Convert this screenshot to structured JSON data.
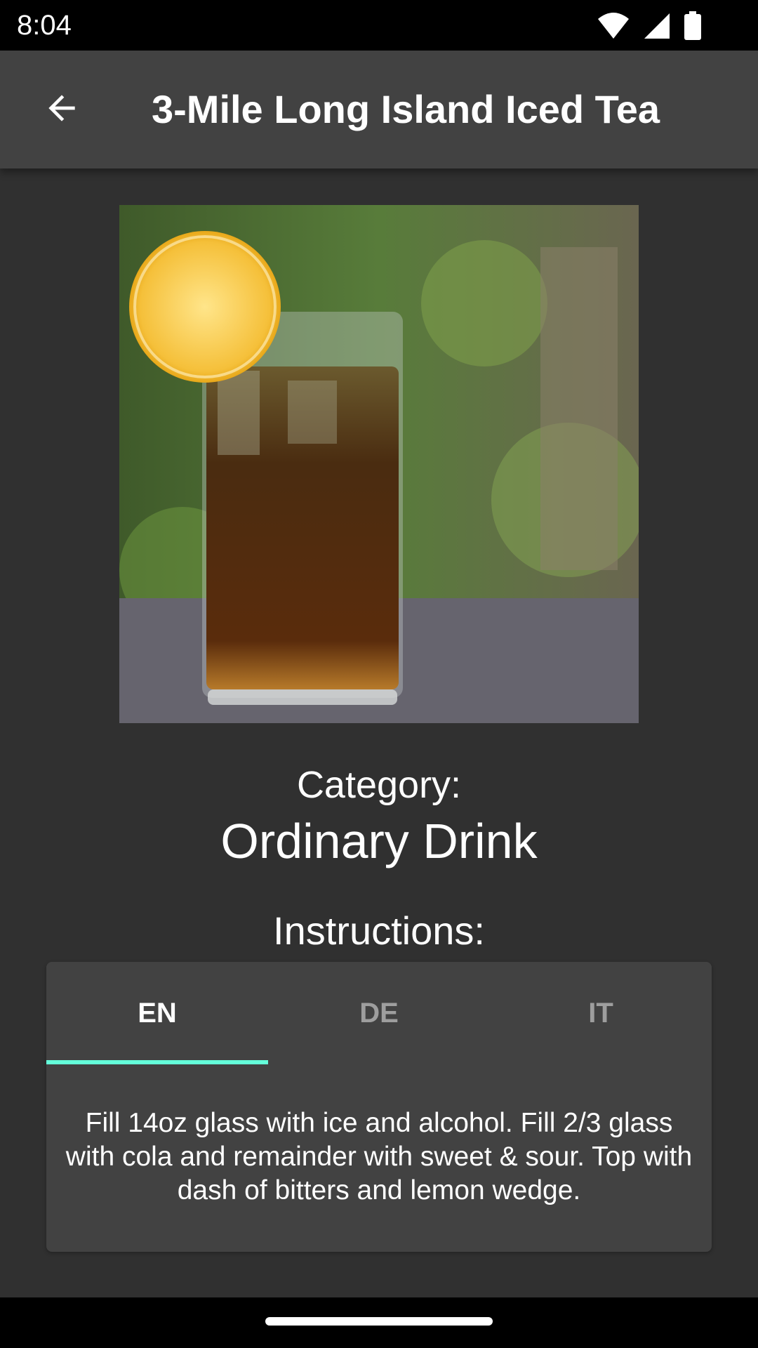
{
  "status_bar": {
    "time": "8:04",
    "icons": [
      "wifi-icon",
      "signal-icon",
      "battery-icon"
    ]
  },
  "app_bar": {
    "title": "3-Mile Long Island Iced Tea",
    "back_icon": "arrow-back-icon"
  },
  "drink": {
    "image_alt": "Glass of iced tea cocktail with lemon slice",
    "category_label": "Category:",
    "category_value": "Ordinary Drink",
    "instructions_label": "Instructions:"
  },
  "tabs": [
    {
      "label": "EN",
      "active": true
    },
    {
      "label": "DE",
      "active": false
    },
    {
      "label": "IT",
      "active": false
    }
  ],
  "instructions_text": "Fill 14oz glass with ice and alcohol. Fill 2/3 glass with cola and remainder with sweet & sour. Top with dash of bitters and lemon wedge.",
  "colors": {
    "background": "#303030",
    "app_bar": "#424242",
    "card": "#424242",
    "accent": "#64FFDA"
  }
}
